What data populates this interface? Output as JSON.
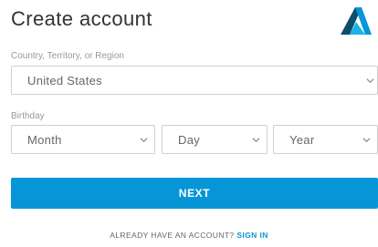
{
  "header": {
    "title": "Create account",
    "logo_icon": "autodesk-logo-icon",
    "logo_color": "#0696d7"
  },
  "country": {
    "label": "Country, Territory, or Region",
    "selected": "United States"
  },
  "birthday": {
    "label": "Birthday",
    "month": "Month",
    "day": "Day",
    "year": "Year"
  },
  "actions": {
    "next_label": "NEXT",
    "next_color": "#0696d7"
  },
  "footer": {
    "question": "ALREADY HAVE AN ACCOUNT?",
    "signin_label": "SIGN IN"
  }
}
